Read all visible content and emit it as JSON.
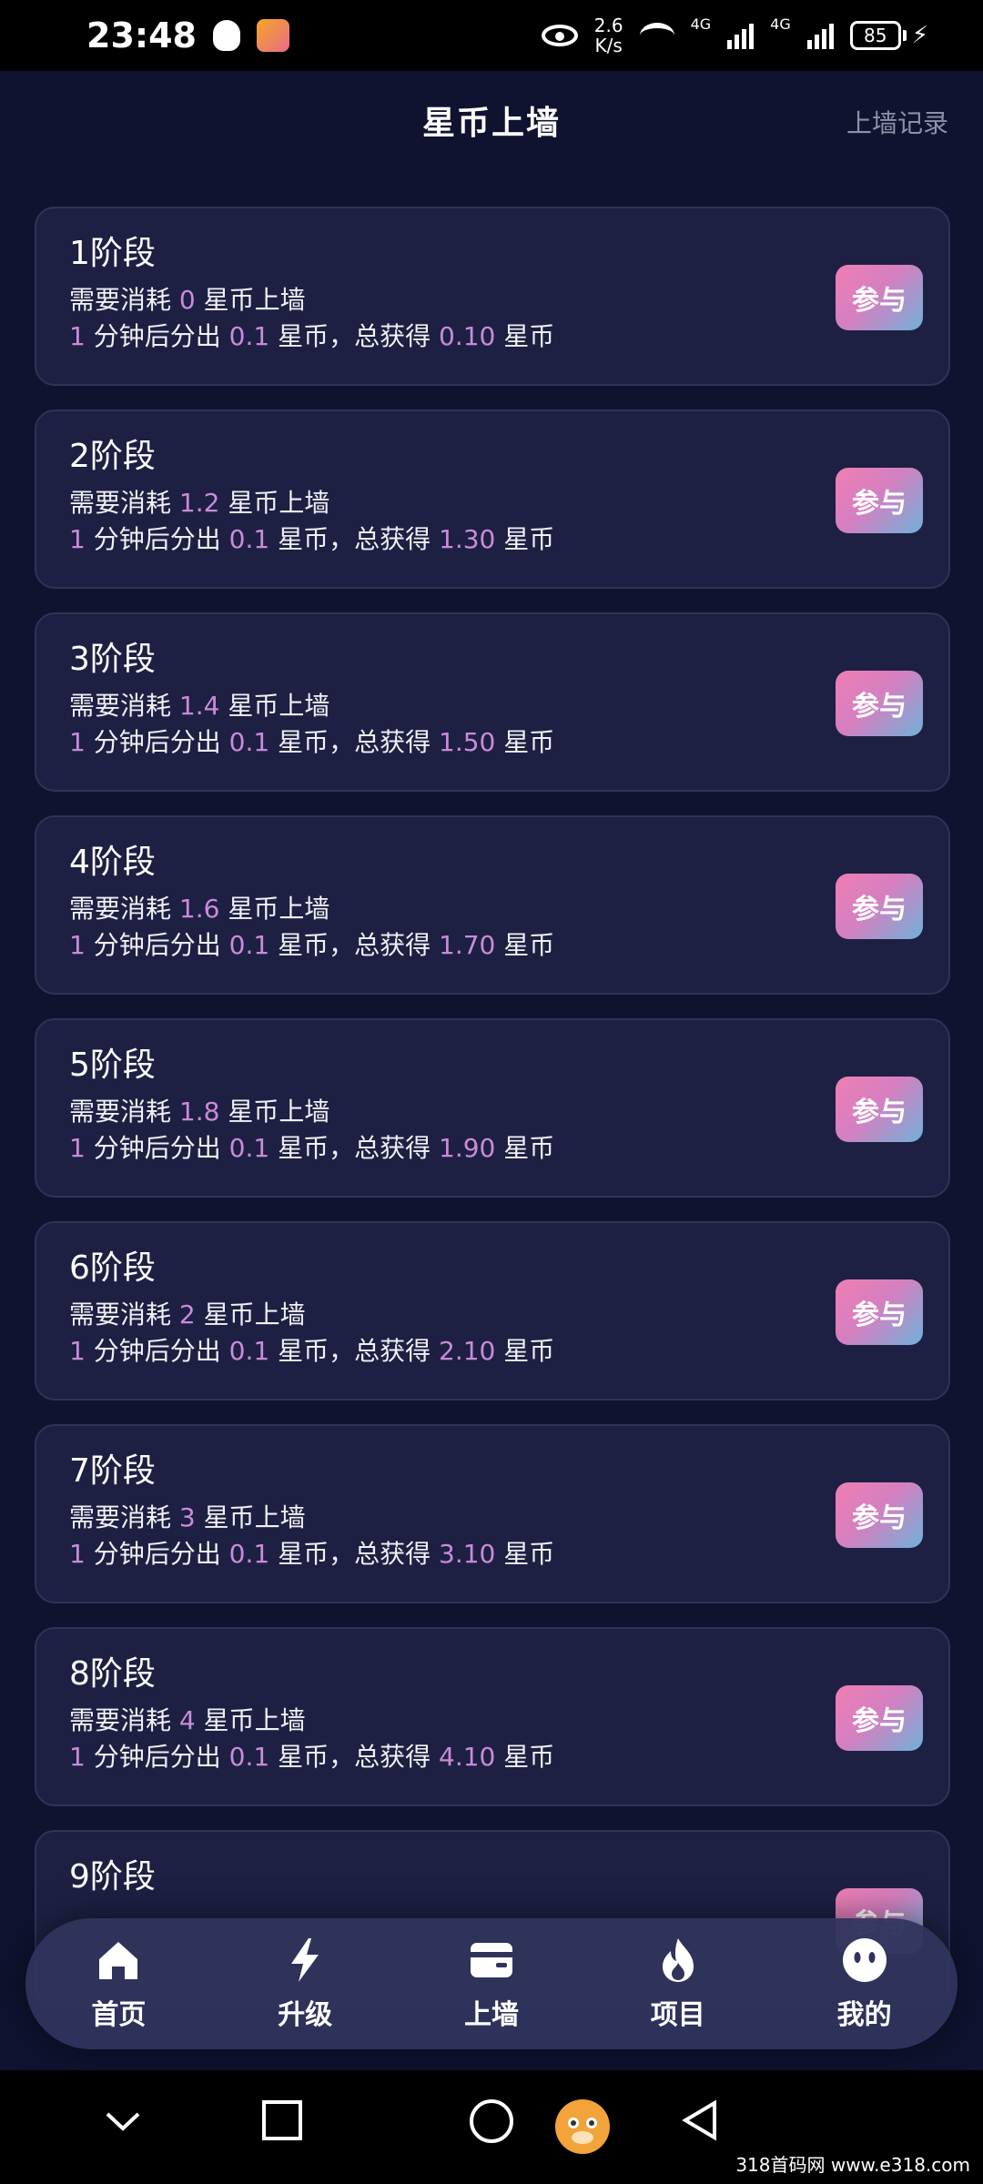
{
  "status_bar": {
    "time": "23:48",
    "speed_top": "2.6",
    "speed_bottom": "K/s",
    "net1": "4G",
    "net2": "4G",
    "battery": "85"
  },
  "header": {
    "title": "星币上墙",
    "record_link": "上墙记录"
  },
  "common": {
    "consume_prefix": "需要消耗",
    "consume_suffix": "星币上墙",
    "minute_prefix": "分钟后分出",
    "total_mid": "星币，总获得",
    "total_suffix": "星币",
    "join_label": "参与"
  },
  "stages": [
    {
      "title": "1阶段",
      "cost": "0",
      "minutes": "1",
      "output": "0.1",
      "total": "0.10"
    },
    {
      "title": "2阶段",
      "cost": "1.2",
      "minutes": "1",
      "output": "0.1",
      "total": "1.30"
    },
    {
      "title": "3阶段",
      "cost": "1.4",
      "minutes": "1",
      "output": "0.1",
      "total": "1.50"
    },
    {
      "title": "4阶段",
      "cost": "1.6",
      "minutes": "1",
      "output": "0.1",
      "total": "1.70"
    },
    {
      "title": "5阶段",
      "cost": "1.8",
      "minutes": "1",
      "output": "0.1",
      "total": "1.90"
    },
    {
      "title": "6阶段",
      "cost": "2",
      "minutes": "1",
      "output": "0.1",
      "total": "2.10"
    },
    {
      "title": "7阶段",
      "cost": "3",
      "minutes": "1",
      "output": "0.1",
      "total": "3.10"
    },
    {
      "title": "8阶段",
      "cost": "4",
      "minutes": "1",
      "output": "0.1",
      "total": "4.10"
    },
    {
      "title": "9阶段"
    }
  ],
  "tabs": [
    {
      "label": "首页",
      "icon": "home-icon"
    },
    {
      "label": "升级",
      "icon": "lightning-icon"
    },
    {
      "label": "上墙",
      "icon": "card-icon"
    },
    {
      "label": "项目",
      "icon": "fire-icon"
    },
    {
      "label": "我的",
      "icon": "face-icon"
    }
  ],
  "watermark": "318首码网 www.e318.com",
  "colors": {
    "background": "#0f1330",
    "card": "#1d2042",
    "highlight": "#c98bd9",
    "button_gradient_start": "#ef7fb3",
    "button_gradient_end": "#6fb1d9"
  }
}
